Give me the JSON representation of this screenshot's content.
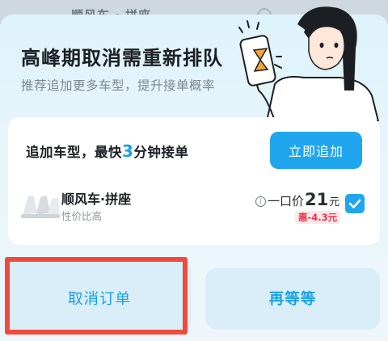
{
  "background": {
    "text": "顺风车 · 拼座"
  },
  "dialog": {
    "title": "高峰期取消需重新排队",
    "subtitle": "推荐追加更多车型，提升接单概率"
  },
  "card": {
    "headline_prefix": "追加车型，最快",
    "headline_number": "3",
    "headline_suffix": "分钟接单",
    "add_button": "立即追加",
    "service": {
      "name": "顺风车·拼座",
      "desc": "性价比高",
      "price_label": "一口价",
      "price": "21",
      "unit": "元",
      "discount": "惠-4.3元",
      "selected": true
    }
  },
  "actions": {
    "cancel": "取消订单",
    "wait": "再等等"
  },
  "colors": {
    "accent": "#1fa6ee",
    "highlight": "#f04a3c",
    "discount": "#e6374a"
  }
}
